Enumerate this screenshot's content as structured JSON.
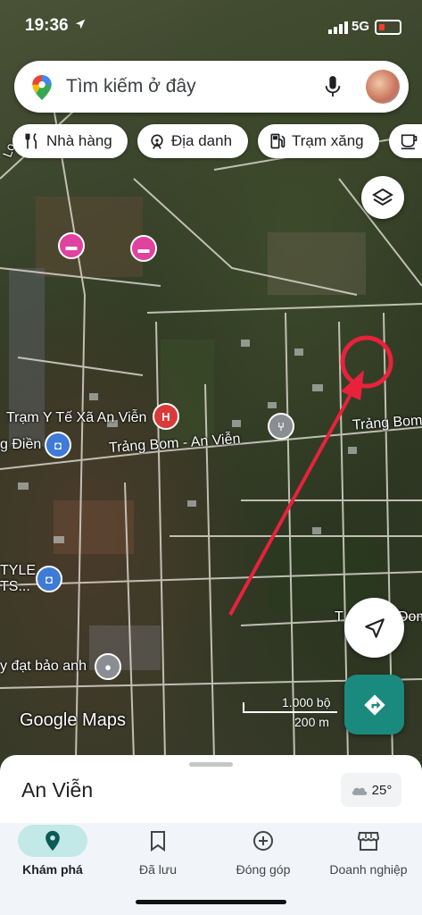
{
  "status": {
    "time": "19:36",
    "network": "5G"
  },
  "search": {
    "placeholder": "Tìm kiếm ở đây"
  },
  "chips": [
    {
      "label": "Nhà hàng",
      "icon": "fork-knife-icon"
    },
    {
      "label": "Địa danh",
      "icon": "landmark-icon"
    },
    {
      "label": "Trạm xăng",
      "icon": "gas-pump-icon"
    },
    {
      "label": "",
      "icon": "coffee-icon"
    }
  ],
  "map": {
    "labels": {
      "health_station": "Trạm Y Tế Xã An Viễn",
      "road_main": "Trảng Bom - An Viễn",
      "road_east": "Trảng Bom",
      "left_dien": "g Điền",
      "style_store": "TYLE\nTS...",
      "land_store": "y đạt bảo anh",
      "right_bottom": "T",
      "right_bottom2": "Dom",
      "road_top": "Lo",
      "watermark": "Google Maps"
    },
    "scale": {
      "feet": "1.000 bộ",
      "meters": "200 m"
    }
  },
  "sheet": {
    "place_title": "An Viễn",
    "temperature": "25°"
  },
  "nav": [
    {
      "label": "Khám phá",
      "icon": "explore-pin-icon",
      "active": true
    },
    {
      "label": "Đã lưu",
      "icon": "bookmark-icon",
      "active": false
    },
    {
      "label": "Đóng góp",
      "icon": "add-circle-icon",
      "active": false
    },
    {
      "label": "Doanh nghiệp",
      "icon": "storefront-icon",
      "active": false
    }
  ]
}
